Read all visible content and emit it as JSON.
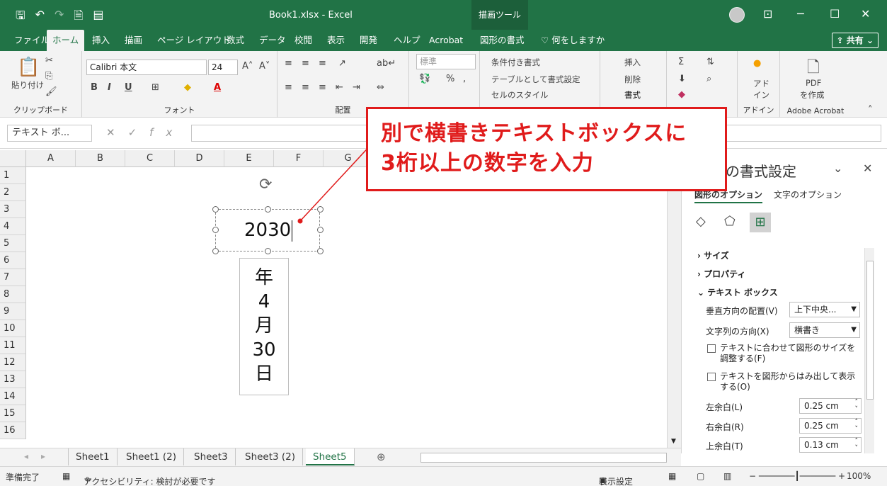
{
  "window": {
    "title": "Book1.xlsx  -  Excel",
    "context_tab": "描画ツール",
    "minimize_icon": "minimize-icon",
    "maximize_icon": "maximize-icon",
    "close_icon": "close-icon"
  },
  "ribbon_tabs": [
    "ファイル",
    "ホーム",
    "挿入",
    "描画",
    "ページ レイアウト",
    "数式",
    "データ",
    "校閲",
    "表示",
    "開発",
    "ヘルプ",
    "Acrobat",
    "図形の書式"
  ],
  "tell_me": "何をしますか",
  "share_label": "共有",
  "ribbon": {
    "clipboard": {
      "paste": "貼り付け",
      "label": "クリップボード"
    },
    "font": {
      "name": "Calibri 本文",
      "size": "24",
      "label": "フォント"
    },
    "alignment": {
      "label": "配置"
    },
    "number": {
      "format": "標準"
    },
    "styles": {
      "conditional": "条件付き書式",
      "table": "テーブルとして書式設定",
      "cell": "セルのスタイル"
    },
    "cells": {
      "insert": "挿入",
      "delete": "削除",
      "format": "書式"
    },
    "addin": {
      "line1": "アド",
      "line2": "イン",
      "label": "アドイン"
    },
    "acrobat": {
      "line1": "PDF",
      "line2": "を作成",
      "label": "Adobe Acrobat"
    }
  },
  "formula_bar": {
    "name_box": "テキスト ボ...",
    "fx": "fx"
  },
  "columns": [
    "A",
    "B",
    "C",
    "D",
    "E",
    "F",
    "G"
  ],
  "rows": [
    "1",
    "2",
    "3",
    "4",
    "5",
    "6",
    "7",
    "8",
    "9",
    "10",
    "11",
    "12",
    "13",
    "14",
    "15",
    "16"
  ],
  "textbox_horizontal": {
    "value": "2030"
  },
  "textbox_vertical": {
    "lines": [
      "年",
      "4",
      "月",
      "30",
      "日"
    ]
  },
  "callout": {
    "line1": "別で横書きテキストボックスに",
    "line2": "3桁以上の数字を入力"
  },
  "format_pane": {
    "title": "の書式設定",
    "tab_shape": "図形のオプション",
    "tab_text": "文字のオプション",
    "section_size": "サイズ",
    "section_props": "プロパティ",
    "section_textbox": "テキスト ボックス",
    "vertical_align_label": "垂直方向の配置(V)",
    "vertical_align_value": "上下中央...",
    "text_direction_label": "文字列の方向(X)",
    "text_direction_value": "横書き",
    "autofit_label": "テキストに合わせて図形のサイズを調整する(F)",
    "overflow_label": "テキストを図形からはみ出して表示する(O)",
    "left_margin_label": "左余白(L)",
    "left_margin_value": "0.25 cm",
    "right_margin_label": "右余白(R)",
    "right_margin_value": "0.25 cm",
    "top_margin_label": "上余白(T)",
    "top_margin_value": "0.13 cm"
  },
  "sheets": [
    "Sheet1",
    "Sheet1 (2)",
    "Sheet3",
    "Sheet3 (2)",
    "Sheet5"
  ],
  "active_sheet": "Sheet5",
  "status": {
    "ready": "準備完了",
    "accessibility": "アクセシビリティ: 検討が必要です",
    "display_settings": "表示設定",
    "zoom": "100%"
  },
  "colors": {
    "excel_green": "#217346",
    "callout_red": "#e01b1b"
  }
}
